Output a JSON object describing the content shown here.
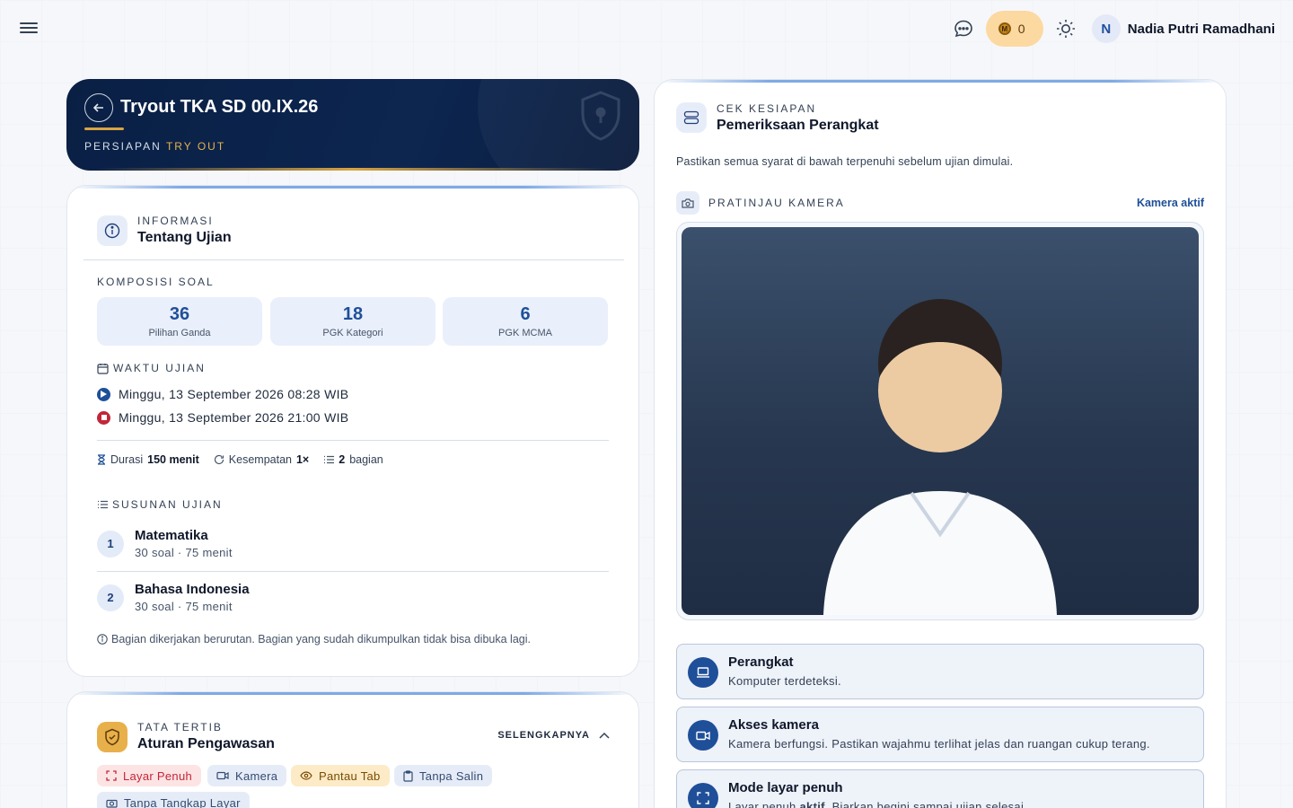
{
  "topbar": {
    "coins": "0",
    "coin_glyph": "M",
    "avatar_initial": "N",
    "user_name": "Nadia Putri Ramadhani"
  },
  "hero": {
    "title": "Tryout TKA SD 00.IX.26",
    "subtitle_prefix": "PERSIAPAN",
    "subtitle_accent": "TRY OUT"
  },
  "info": {
    "eyebrow": "INFORMASI",
    "title": "Tentang Ujian",
    "composition_label": "KOMPOSISI SOAL",
    "composition": [
      {
        "num": "36",
        "label": "Pilihan Ganda"
      },
      {
        "num": "18",
        "label": "PGK Kategori"
      },
      {
        "num": "6",
        "label": "PGK MCMA"
      }
    ],
    "time_label": "WAKTU UJIAN",
    "start": "Minggu, 13 September 2026 08:28 WIB",
    "end": "Minggu, 13 September 2026 21:00 WIB",
    "duration_prefix": "Durasi",
    "duration_value": "150 menit",
    "attempts_prefix": "Kesempatan",
    "attempts_value": "1×",
    "parts_value": "2",
    "parts_suffix": "bagian",
    "structure_label": "SUSUNAN UJIAN",
    "parts": [
      {
        "n": "1",
        "name": "Matematika",
        "detail": "30 soal · 75 menit"
      },
      {
        "n": "2",
        "name": "Bahasa Indonesia",
        "detail": "30 soal · 75 menit"
      }
    ],
    "note": "Bagian dikerjakan berurutan. Bagian yang sudah dikumpulkan tidak bisa dibuka lagi."
  },
  "rules": {
    "eyebrow": "TATA TERTIB",
    "title": "Aturan Pengawasan",
    "more": "SELENGKAPNYA",
    "chips": [
      "Layar Penuh",
      "Kamera",
      "Pantau Tab",
      "Tanpa Salin",
      "Tanpa Tangkap Layar"
    ]
  },
  "readiness": {
    "eyebrow": "CEK KESIAPAN",
    "title": "Pemeriksaan Perangkat",
    "intro": "Pastikan semua syarat di bawah terpenuhi sebelum ujian dimulai.",
    "camera_label": "PRATINJAU KAMERA",
    "camera_status": "Kamera aktif",
    "checks": [
      {
        "title": "Perangkat",
        "desc": "Komputer terdeteksi."
      },
      {
        "title": "Akses kamera",
        "desc": "Kamera berfungsi. Pastikan wajahmu terlihat jelas dan ruangan cukup terang."
      },
      {
        "title": "Mode layar penuh",
        "desc_prefix": "Layar penuh",
        "desc_bold": "aktif",
        "desc_suffix": ". Biarkan begini sampai ujian selesai."
      }
    ]
  },
  "colors": {
    "primary": "#1f4f98",
    "navy": "#0a1f44",
    "gold": "#d9a441",
    "danger": "#c2263a"
  }
}
